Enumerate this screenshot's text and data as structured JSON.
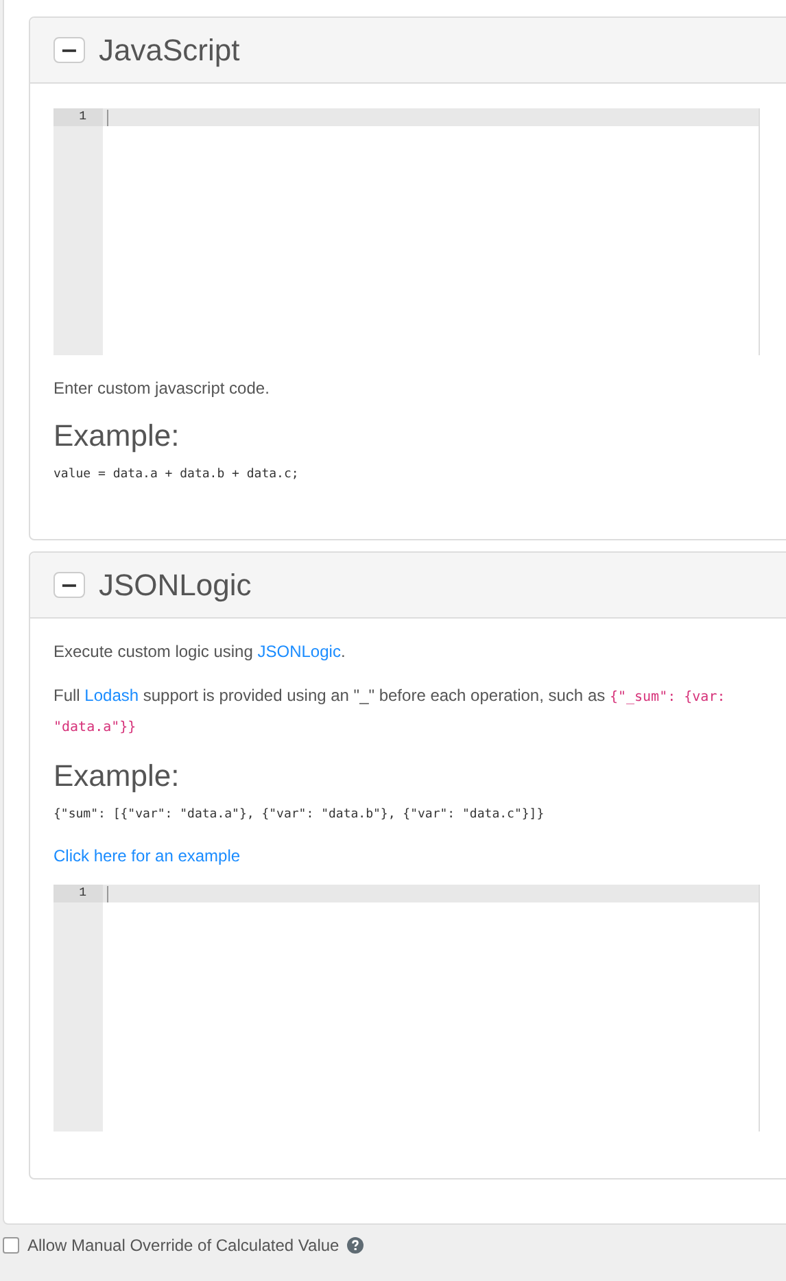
{
  "panels": [
    {
      "title": "JavaScript",
      "collapse_symbol": "−",
      "kind": "javascript",
      "blocks": [
        {
          "kind": "editor",
          "line_numbers": [
            "1"
          ]
        },
        {
          "kind": "paragraph",
          "parts": [
            {
              "kind": "text",
              "text": "Enter custom javascript code."
            }
          ]
        },
        {
          "kind": "heading",
          "text": "Example:"
        },
        {
          "kind": "code",
          "text": "value = data.a + data.b + data.c;"
        }
      ]
    },
    {
      "title": "JSONLogic",
      "collapse_symbol": "−",
      "kind": "jsonlogic",
      "blocks": [
        {
          "kind": "paragraph",
          "parts": [
            {
              "kind": "text",
              "text": "Execute custom logic using "
            },
            {
              "kind": "link",
              "text": "JSONLogic"
            },
            {
              "kind": "text",
              "text": "."
            }
          ]
        },
        {
          "kind": "paragraph",
          "parts": [
            {
              "kind": "text",
              "text": "Full "
            },
            {
              "kind": "link",
              "text": "Lodash"
            },
            {
              "kind": "text",
              "text": " support is provided using an \"_\" before each operation, such as "
            },
            {
              "kind": "code",
              "text": "{\"_sum\": {var: \"data.a\"}}"
            }
          ]
        },
        {
          "kind": "heading",
          "text": "Example:"
        },
        {
          "kind": "code",
          "text": "{\"sum\": [{\"var\": \"data.a\"}, {\"var\": \"data.b\"}, {\"var\": \"data.c\"}]}"
        },
        {
          "kind": "link",
          "text": "Click here for an example"
        },
        {
          "kind": "editor",
          "line_numbers": [
            "1"
          ]
        }
      ]
    }
  ],
  "override": {
    "label": "Allow Manual Override of Calculated Value",
    "checked": false
  }
}
